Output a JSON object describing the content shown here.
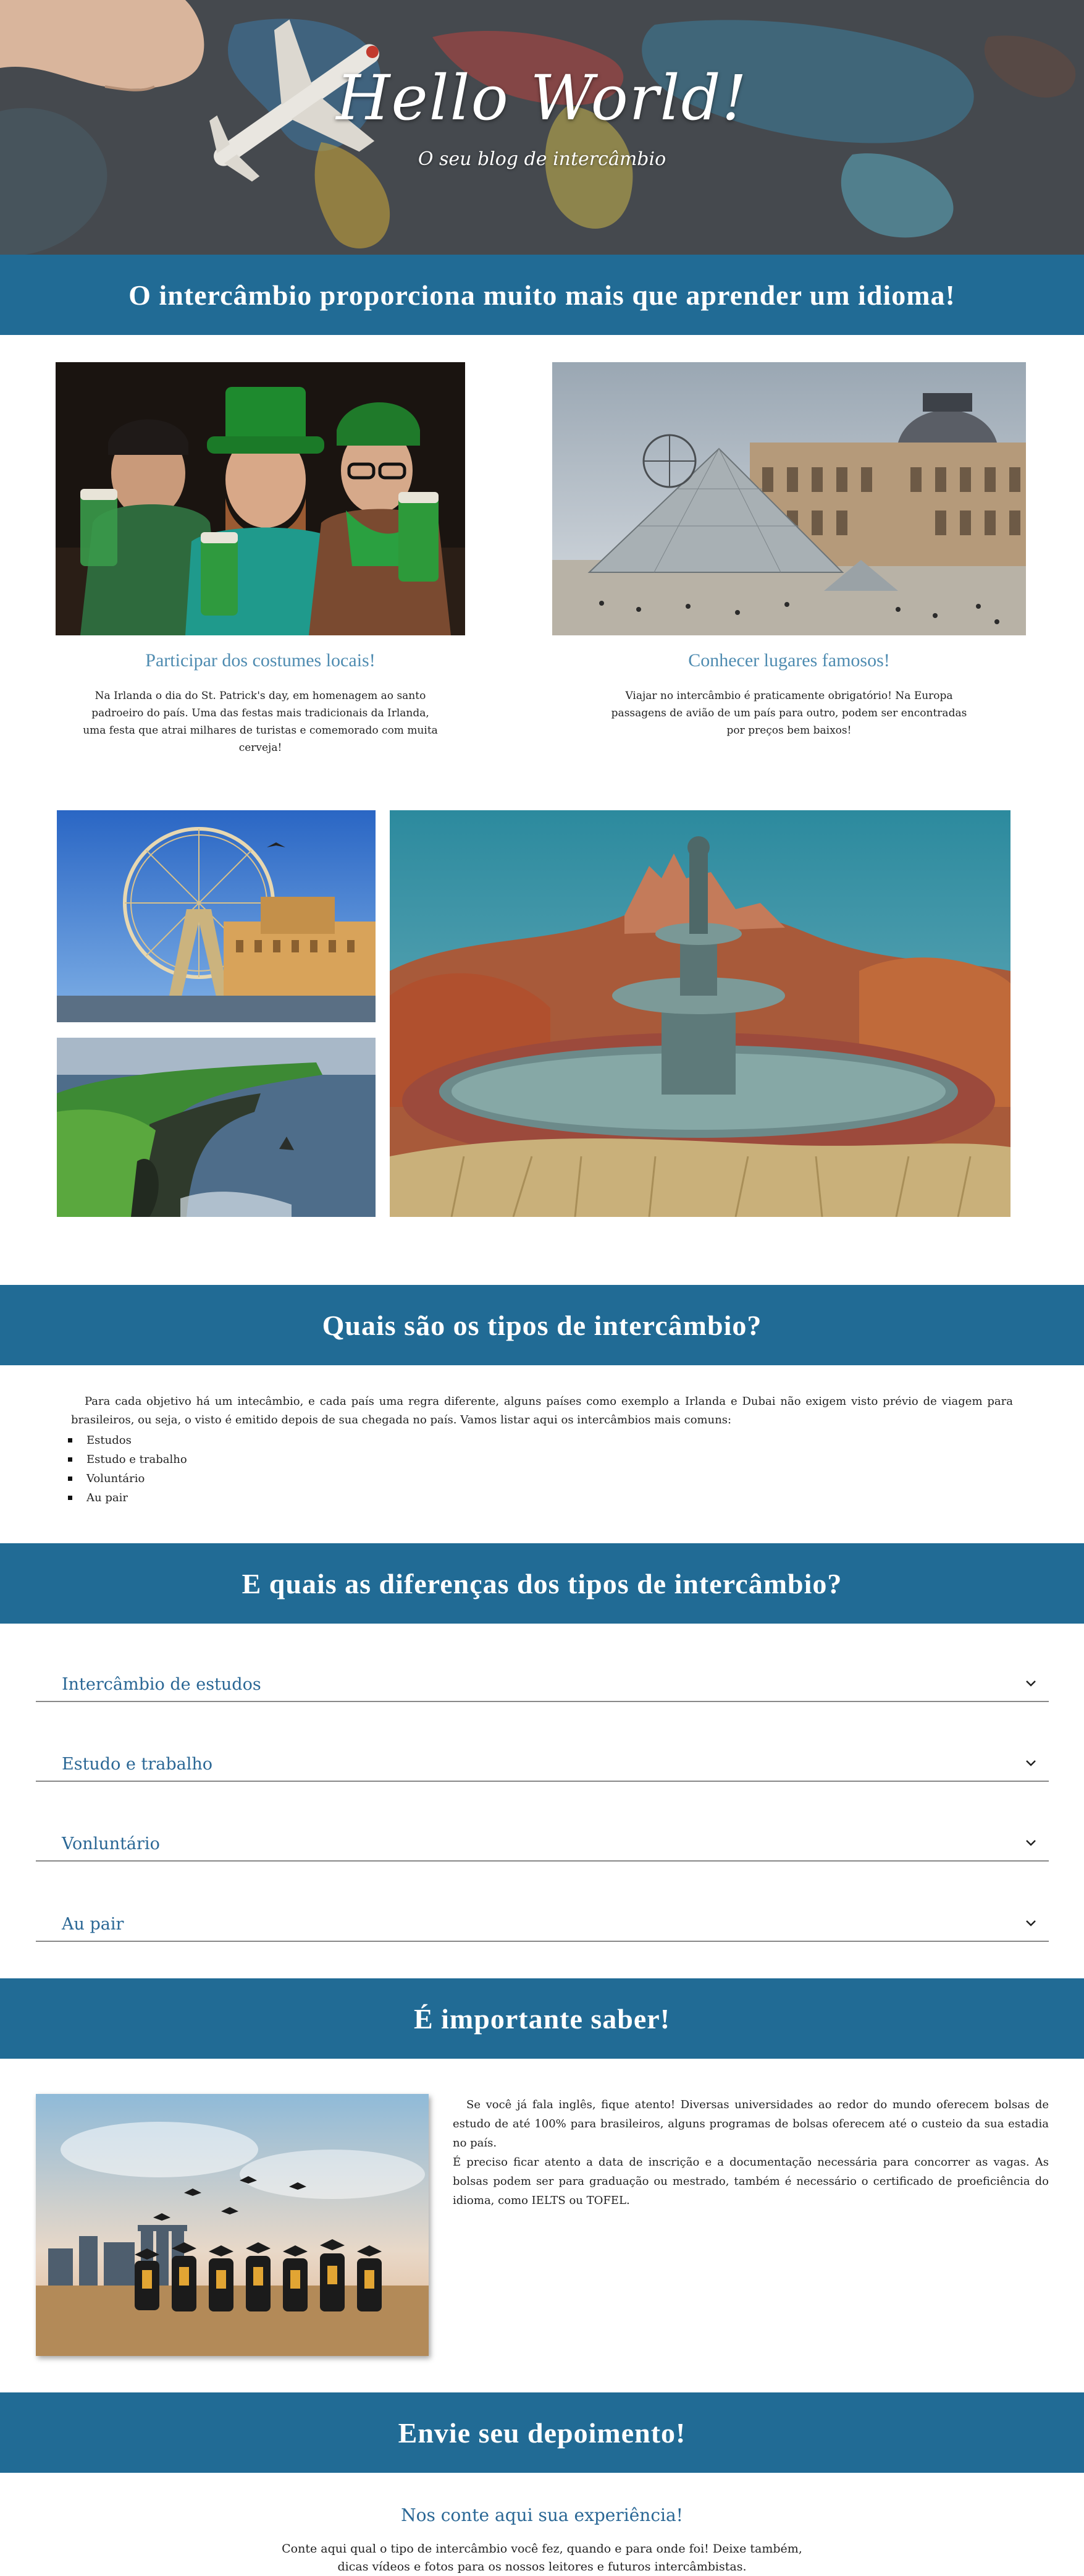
{
  "hero": {
    "title": "Hello World!",
    "subtitle": "O seu blog de intercâmbio"
  },
  "section1": {
    "heading": "O intercâmbio proporciona muito mais que aprender um idioma!",
    "cards": [
      {
        "title": "Participar dos costumes locais!",
        "text": "Na Irlanda o dia do St. Patrick's day, em homenagem ao santo padroeiro do país. Uma das festas mais tradicionais da Irlanda, uma festa que atrai milhares de turistas e comemorado com muita cerveja!"
      },
      {
        "title": "Conhecer lugares famosos!",
        "text": "Viajar no intercâmbio é praticamente obrigatório! Na Europa passagens de avião de um país para outro, podem ser encontradas por preços bem baixos!"
      }
    ]
  },
  "types": {
    "heading": "Quais são os tipos de intercâmbio?",
    "intro": "Para cada objetivo há um intecâmbio, e cada país uma regra diferente, alguns países como exemplo a Irlanda e Dubai não exigem visto prévio de viagem para brasileiros, ou seja, o visto é emitido depois de sua chegada no país. Vamos listar aqui os intercâmbios mais comuns:",
    "items": [
      "Estudos",
      "Estudo e trabalho",
      "Voluntário",
      "Au pair"
    ]
  },
  "differences": {
    "heading": "E quais as diferenças dos tipos de intercâmbio?",
    "items": [
      {
        "label": "Intercâmbio de estudos"
      },
      {
        "label": "Estudo e trabalho"
      },
      {
        "label": "Vonluntário"
      },
      {
        "label": "Au pair"
      }
    ]
  },
  "important": {
    "heading": "É importante saber!",
    "paragraph1": "Se você já fala inglês, fique atento! Diversas universidades ao redor do mundo oferecem bolsas de estudo de até 100% para brasileiros, alguns programas de bolsas oferecem até o custeio da sua estadia no país.",
    "paragraph2": "É preciso ficar atento a data de inscrição e a documentação necessária para concorrer as vagas. As bolsas podem ser para graduação ou mestrado, também é necessário o certificado de proeficiência do idioma, como IELTS ou TOFEL."
  },
  "testimonial": {
    "heading": "Envie seu depoimento!",
    "subheading": "Nos conte aqui sua experiência!",
    "text": "Conte aqui qual o tipo de intercâmbio você fez, quando e para onde foi! Deixe também, dicas vídeos e fotos para os nossos leitores e futuros intercâmbistas."
  },
  "colors": {
    "banner": "#216b95",
    "accent": "#2a6795",
    "card_title": "#4f8cb1"
  }
}
